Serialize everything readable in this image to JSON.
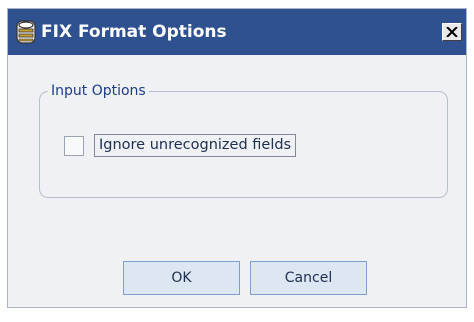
{
  "dialog": {
    "title": "FIX Format Options",
    "close_label": "×",
    "icon": "database-icon"
  },
  "input_options": {
    "legend": "Input Options",
    "ignore_unrecognized": {
      "label": "Ignore unrecognized fields",
      "checked": false
    }
  },
  "buttons": {
    "ok_label": "OK",
    "cancel_label": "Cancel"
  },
  "colors": {
    "titlebar": "#2f5190",
    "window_bg": "#eff1f4",
    "legend_text": "#1c3d8c",
    "button_bg": "#dde6f3",
    "button_border": "#7f9ed0"
  }
}
